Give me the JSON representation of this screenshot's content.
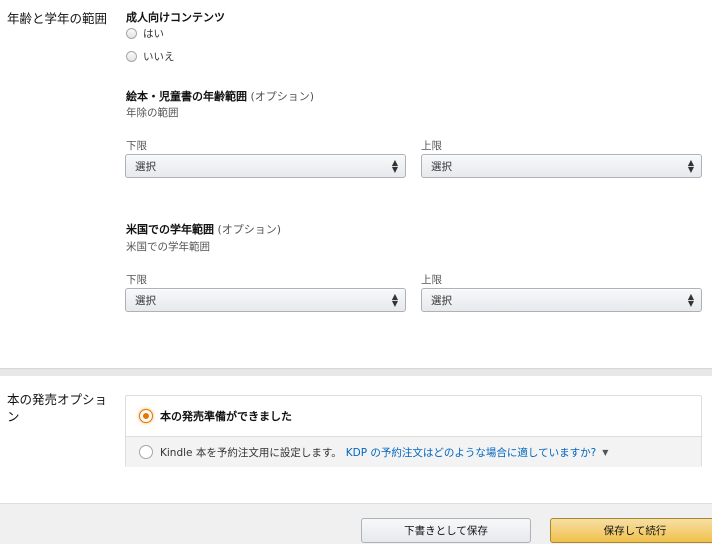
{
  "age_grade_section": {
    "title": "年齢と学年の範囲",
    "adult_content": {
      "label": "成人向けコンテンツ",
      "options": [
        "はい",
        "いいえ"
      ]
    },
    "children_age": {
      "label": "絵本・児童書の年齢範囲",
      "optional": "(オプション)",
      "helper": "年除の範囲",
      "min_label": "下限",
      "max_label": "上限",
      "min_value": "選択",
      "max_value": "選択"
    },
    "us_grade": {
      "label": "米国での学年範囲",
      "optional": "(オプション)",
      "helper": "米国での学年範囲",
      "min_label": "下限",
      "max_label": "上限",
      "min_value": "選択",
      "max_value": "選択"
    }
  },
  "release_section": {
    "title": "本の発売オプション",
    "option_ready": "本の発売準備ができました",
    "option_preorder": "Kindle 本を予約注文用に設定します。",
    "preorder_link": "KDP の予約注文はどのような場合に適していますか?",
    "selected": "ready"
  },
  "footer": {
    "save_draft": "下書きとして保存",
    "save_continue": "保存して続行"
  },
  "colors": {
    "accent_orange": "#e77600",
    "link_blue": "#0066c0",
    "primary_button": "#f0c14b"
  }
}
